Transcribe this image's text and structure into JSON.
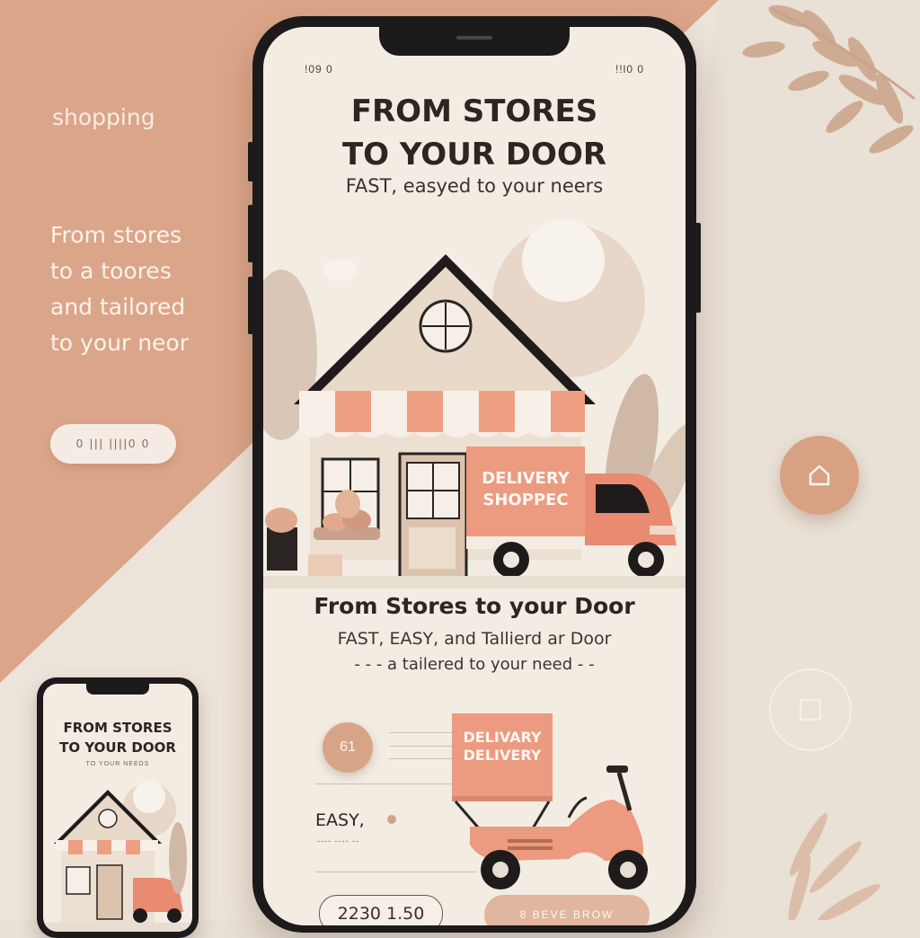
{
  "side": {
    "brand": "shopping",
    "copy": [
      "From stores",
      "to  a toores",
      "and tailored",
      "to your neor"
    ],
    "pill": "0 ||| ||||0 0"
  },
  "phone": {
    "status_left": "!09 0",
    "status_right": "!!l0 0",
    "hero_title_1": "FROM STORES",
    "hero_title_2": "TO YOUR DOOR",
    "hero_sub": "FAST,   easyed to your neers",
    "truck_label_1": "DELIVERY",
    "truck_label_2": "SHOPPEC",
    "section_title": "From Stores to your Door",
    "section_sub_1": "FAST, EASY, and Tallierd   ar Door",
    "section_sub_2": "- - - a tailered to your need - -",
    "step_badge": "61",
    "easy_label": "EASY,",
    "tiny_label": "---- ---- --",
    "box_label_1": "DELIVARY",
    "box_label_2": "DELIVERY",
    "price": "2230  1.50",
    "cta": "8 BEVE BROW"
  },
  "mini": {
    "title_1": "FROM STORES",
    "title_2": "TO YOUR DOOR",
    "sub": "TO YOUR NEEDS"
  },
  "colors": {
    "peach": "#d8a183",
    "cream": "#f2ece3",
    "dark": "#1c1a1a",
    "awning_orange": "#ee9f82",
    "truck_orange": "#ec9a80"
  },
  "icons": {
    "home": "home-icon",
    "square": "square-icon",
    "leaf": "leaf-icon"
  }
}
